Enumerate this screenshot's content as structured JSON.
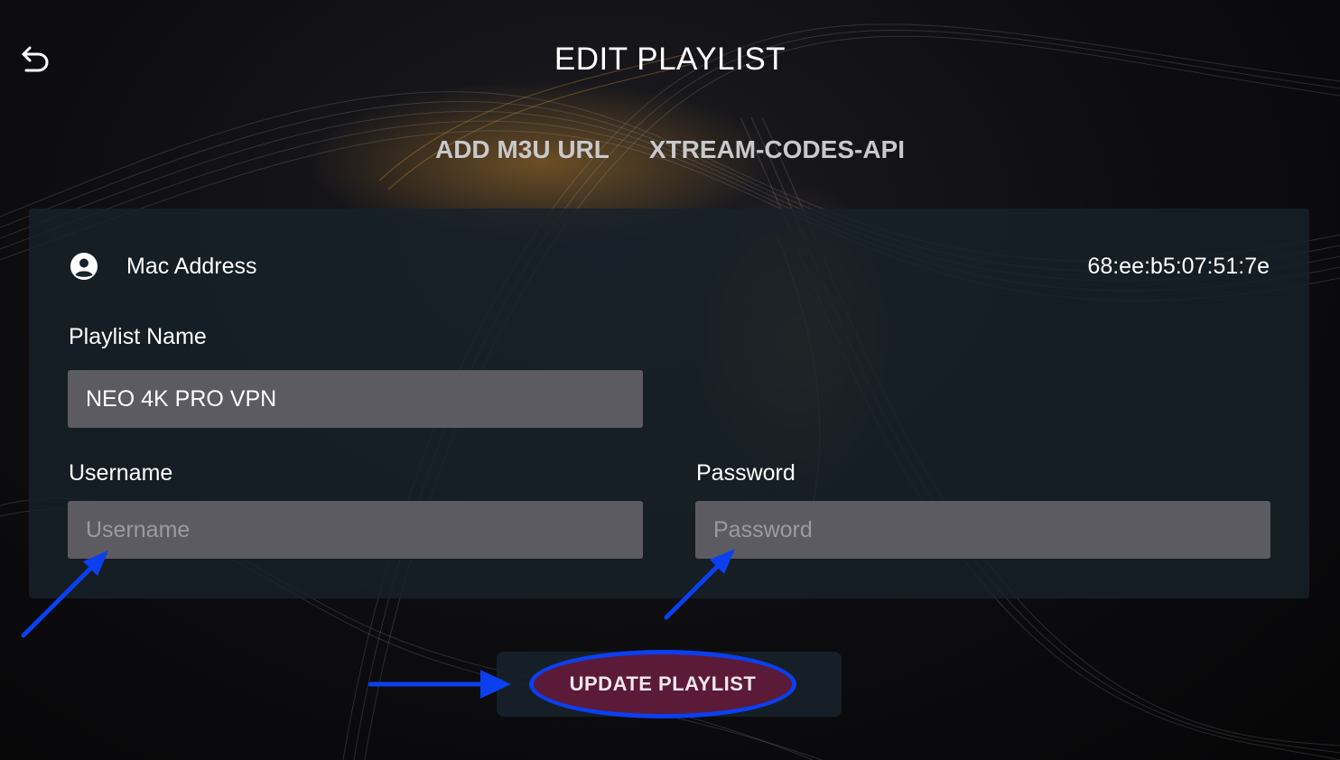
{
  "header": {
    "title": "EDIT PLAYLIST",
    "back_icon": "back-arrow-icon"
  },
  "tabs": [
    {
      "label": "ADD M3U URL",
      "active": false
    },
    {
      "label": "XTREAM-CODES-API",
      "active": false
    }
  ],
  "mac": {
    "icon": "user-circle-icon",
    "label": "Mac Address",
    "value": "68:ee:b5:07:51:7e"
  },
  "form": {
    "playlist_name_label": "Playlist Name",
    "playlist_name_value": "NEO 4K PRO VPN",
    "username_label": "Username",
    "username_placeholder": "Username",
    "username_value": "",
    "password_label": "Password",
    "password_placeholder": "Password",
    "password_value": ""
  },
  "actions": {
    "update_label": "UPDATE PLAYLIST"
  },
  "colors": {
    "panel": "#17212a",
    "field": "#5c5b61",
    "button": "#5a1a38",
    "annotation": "#0b3ff0"
  }
}
